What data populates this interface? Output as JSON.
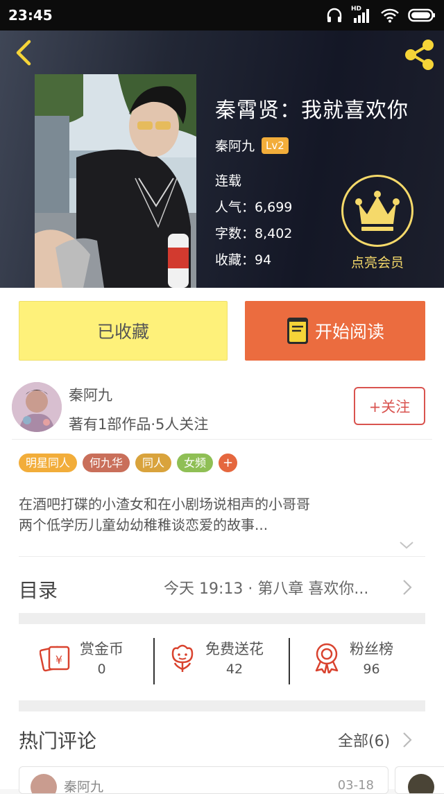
{
  "status_bar": {
    "time": "23:45",
    "network": "HD"
  },
  "header": {
    "back_icon": "chevron-left-icon",
    "share_icon": "share-icon"
  },
  "book": {
    "title": "秦霄贤：我就喜欢你",
    "author": "秦阿九",
    "level": "Lv2",
    "status": "连载",
    "popularity": "人气：6,699",
    "words": "字数：8,402",
    "favorites": "收藏：94"
  },
  "vip": {
    "label": "点亮会员",
    "icon": "crown-icon"
  },
  "actions": {
    "favorited_label": "已收藏",
    "read_label": "开始阅读"
  },
  "author_card": {
    "name": "秦阿九",
    "info": "著有1部作品·5人关注",
    "follow_label": "+关注"
  },
  "tags": [
    {
      "label": "明星同人",
      "color": "#f2ad3a"
    },
    {
      "label": "何九华",
      "color": "#c96f5a"
    },
    {
      "label": "同人",
      "color": "#d9a33c"
    },
    {
      "label": "女频",
      "color": "#8fbf55"
    }
  ],
  "tag_add": "+",
  "description": {
    "line1": "在酒吧打碟的小渣女和在小剧场说相声的小哥哥",
    "line2": "两个低学历儿童幼幼稚稚谈恋爱的故事..."
  },
  "toc": {
    "label": "目录",
    "latest": "今天 19:13 · 第八章 喜欢你..."
  },
  "stats": [
    {
      "label": "赏金币",
      "value": "0",
      "icon": "reward-coin-icon"
    },
    {
      "label": "免费送花",
      "value": "42",
      "icon": "flower-icon"
    },
    {
      "label": "粉丝榜",
      "value": "96",
      "icon": "ribbon-badge-icon"
    }
  ],
  "comments": {
    "title": "热门评论",
    "all_label": "全部(6)",
    "first": {
      "user": "秦阿九",
      "date": "03-18"
    }
  },
  "colors": {
    "accent": "#eb6c3f",
    "favorite_bg": "#fef17a",
    "vip": "#f5d96a",
    "follow": "#d9534f"
  }
}
